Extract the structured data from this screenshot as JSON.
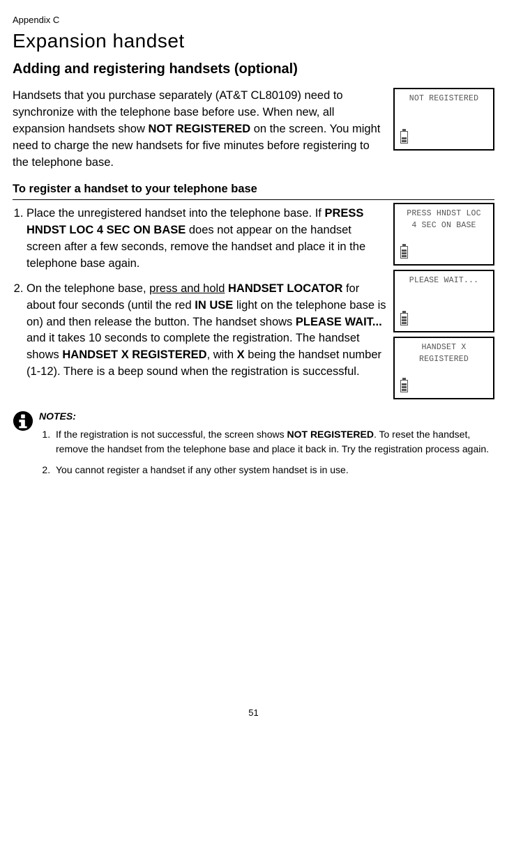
{
  "appendix": "Appendix C",
  "title": "Expansion handset",
  "subtitle": "Adding and registering handsets (optional)",
  "intro": {
    "t1": "Handsets that you purchase separately (AT&T CL80109) need to synchronize with the telephone base before use. When new, all expansion handsets show ",
    "b1": "NOT REGISTERED",
    "t2": " on the screen. You might need to charge the new handsets for five minutes before registering to the telephone base."
  },
  "register_heading": "To register a handset to your telephone base",
  "step1": {
    "t1": "Place the unregistered handset into the telephone base. If ",
    "b1": "PRESS HNDST LOC 4 SEC ON BASE",
    "t2": " does not appear on the handset screen after a few seconds, remove the handset and place it in the telephone base again."
  },
  "step2": {
    "t1": "On the telephone base, ",
    "u1": "press and hold",
    "t2": " ",
    "b1": "HANDSET LOCATOR",
    "t3": " for about four seconds (until the red ",
    "b2": "IN USE",
    "t4": " light on the telephone base is on) and then release the button. The handset shows ",
    "b3": "PLEASE WAIT...",
    "t5": " and it takes 10 seconds to complete the registration. The handset shows ",
    "b4": "HANDSET X REGISTERED",
    "t6": ", with ",
    "b5": "X",
    "t7": " being the handset number (1-12). There is a beep sound when the registration is successful."
  },
  "lcd": {
    "not_registered": "NOT REGISTERED",
    "press_line1": "PRESS HNDST LOC",
    "press_line2": "4 SEC ON BASE",
    "please_wait": "PLEASE WAIT...",
    "handset_x_l1": "HANDSET X",
    "handset_x_l2": "REGISTERED"
  },
  "notes_title": "NOTES:",
  "note1": {
    "t1": "If the registration is not successful, the screen shows ",
    "b1": "NOT REGISTERED",
    "t2": ". To reset the handset, remove the handset from the telephone base and place it back in. Try the registration process again."
  },
  "note2": "You cannot register a handset if any other system handset is in use.",
  "page_number": "51"
}
